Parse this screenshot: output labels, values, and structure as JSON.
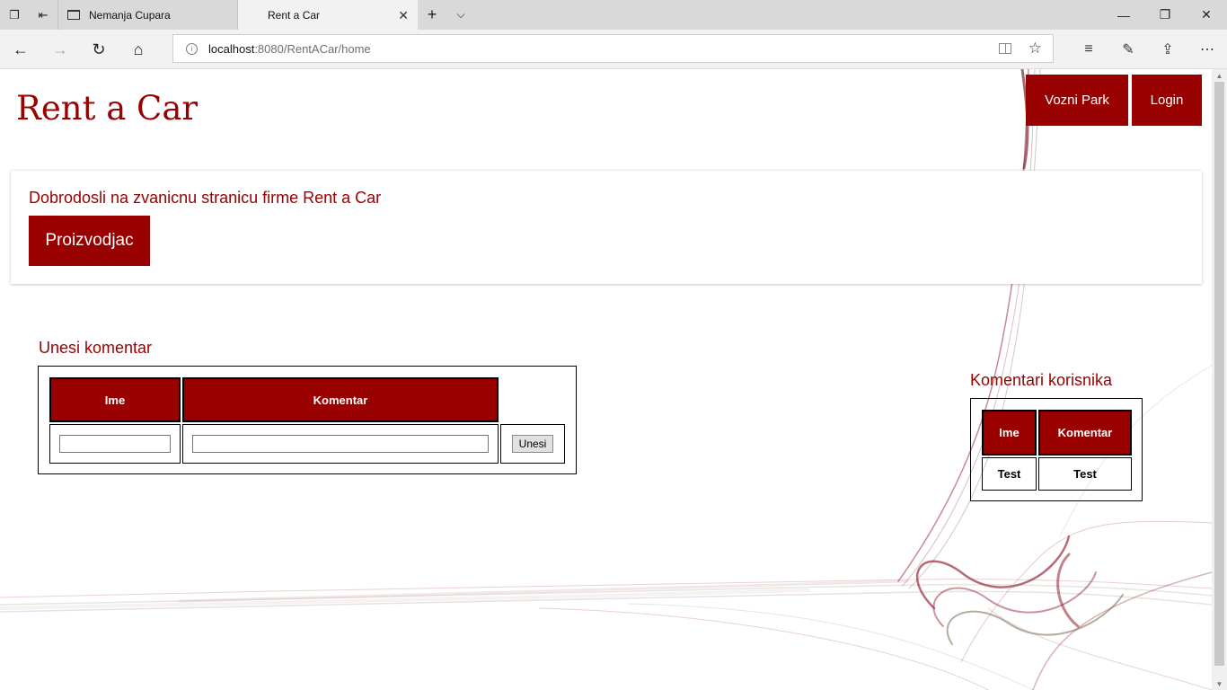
{
  "browser": {
    "tabs": [
      {
        "title": "Nemanja Cupara"
      },
      {
        "title": "Rent a Car"
      }
    ],
    "url_host": "localhost",
    "url_path": ":8080/RentACar/home"
  },
  "site": {
    "title": "Rent a Car",
    "nav": {
      "fleet": "Vozni Park",
      "login": "Login"
    }
  },
  "welcome": {
    "heading": "Dobrodosli na zvanicnu stranicu firme Rent a Car",
    "manufacturer_button": "Proizvodjac"
  },
  "comment_form": {
    "title": "Unesi komentar",
    "col_name": "Ime",
    "col_comment": "Komentar",
    "name_value": "",
    "comment_value": "",
    "submit": "Unesi"
  },
  "comments": {
    "title": "Komentari korisnika",
    "col_name": "Ime",
    "col_comment": "Komentar",
    "rows": [
      {
        "name": "Test",
        "comment": "Test"
      }
    ]
  },
  "colors": {
    "accent": "#990000"
  }
}
